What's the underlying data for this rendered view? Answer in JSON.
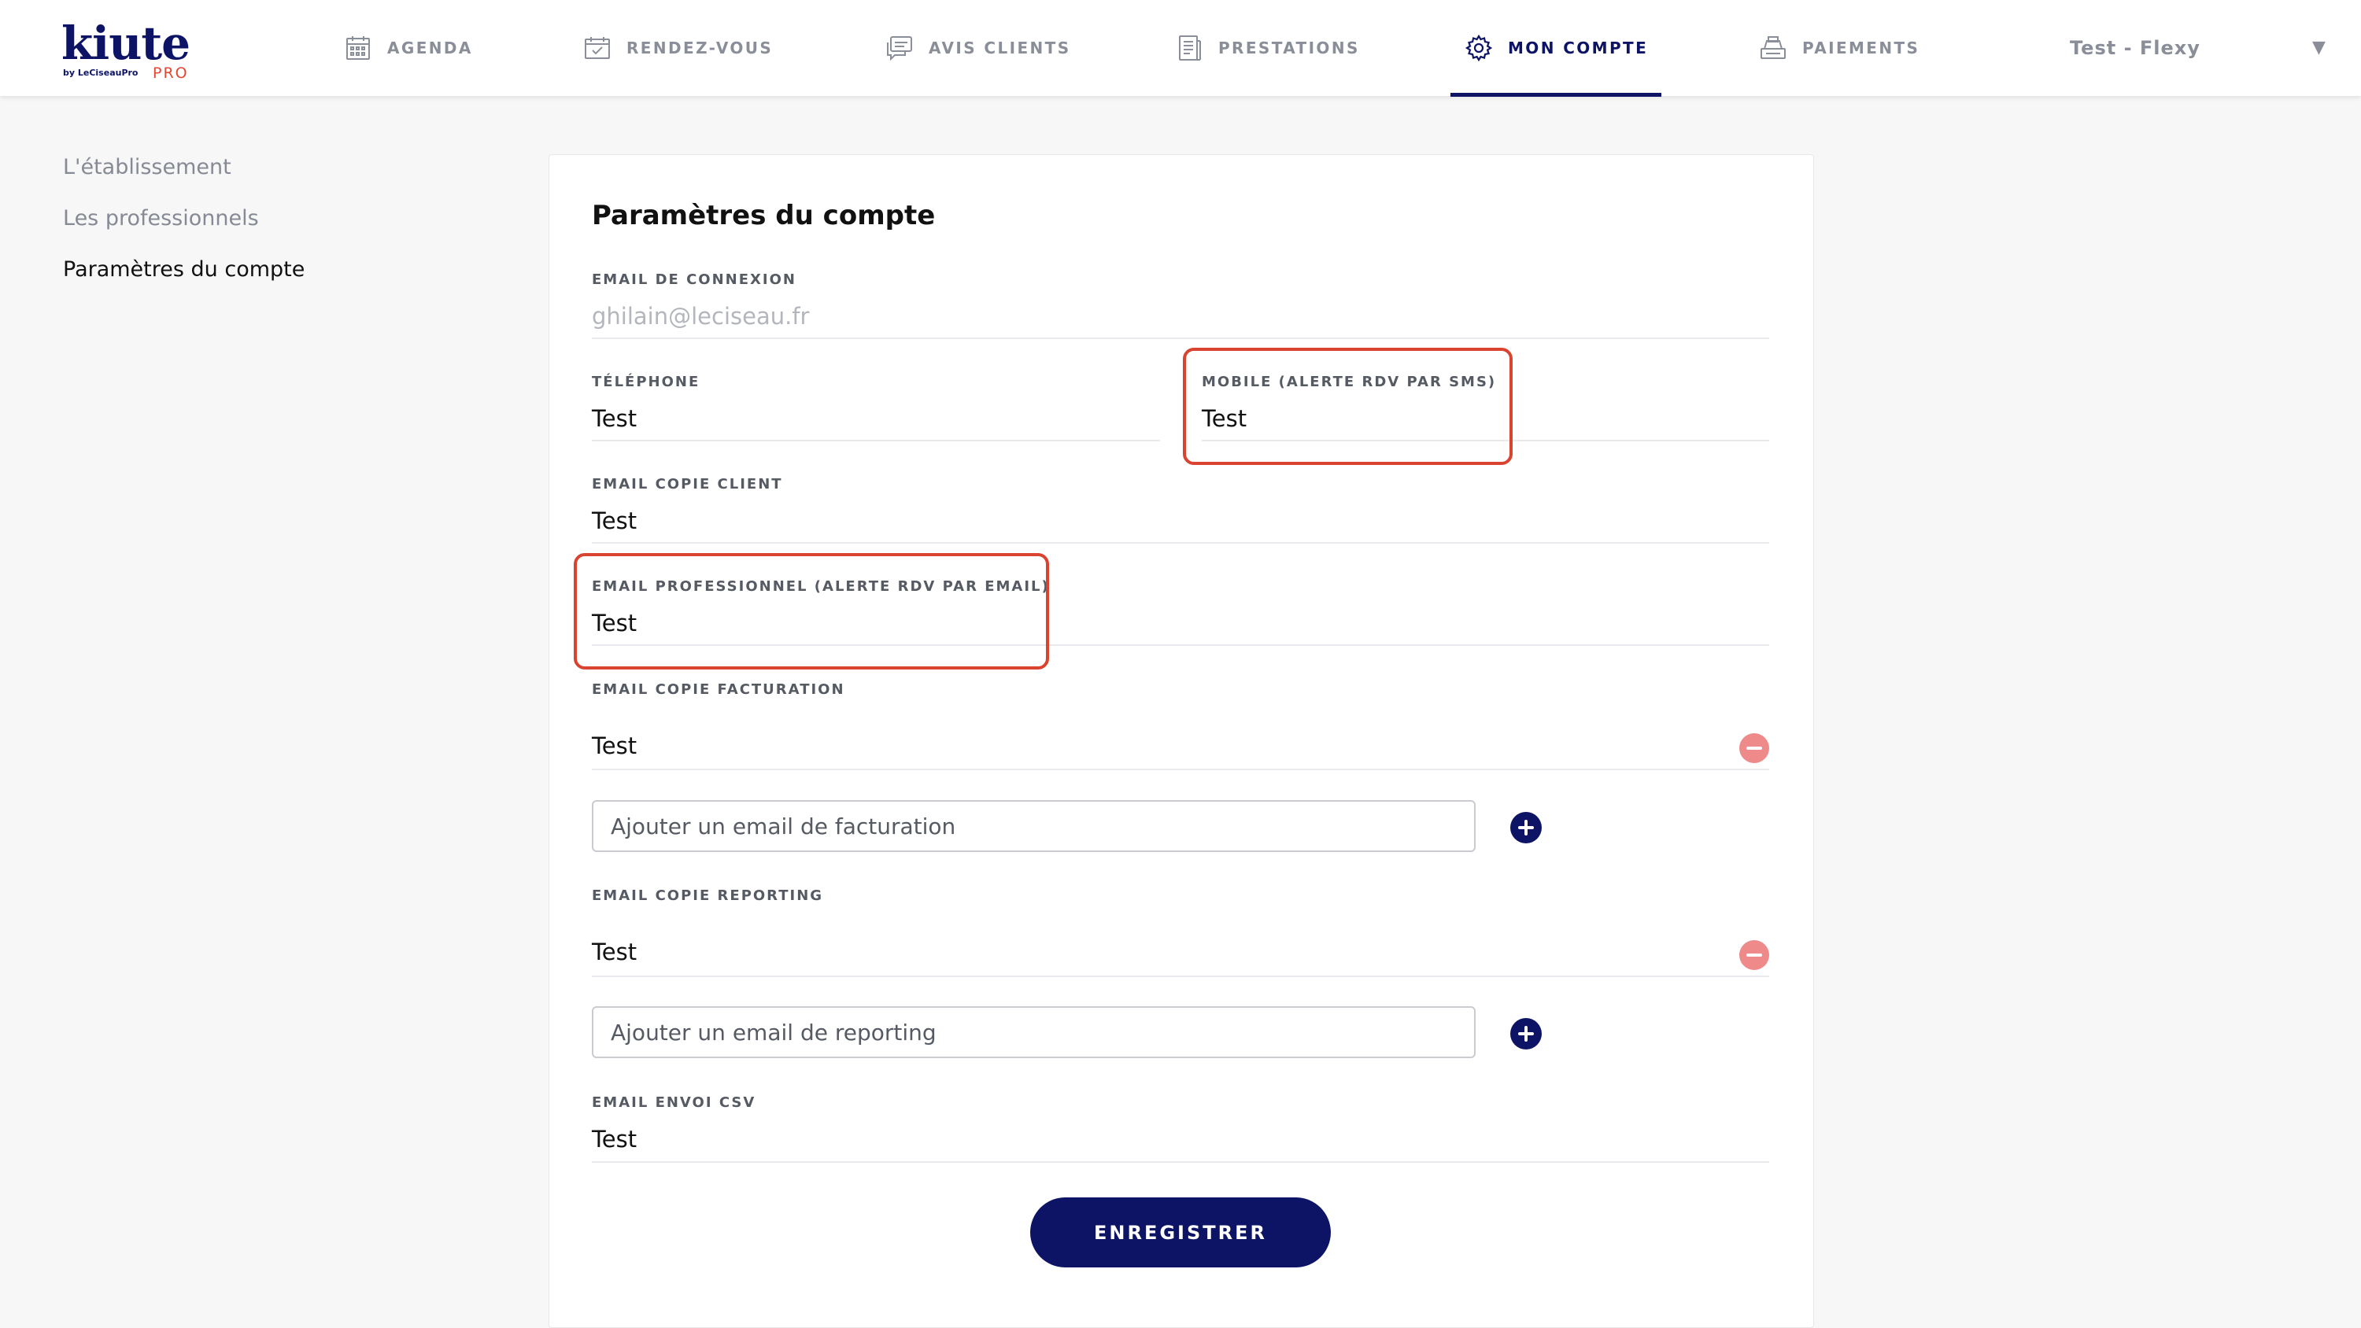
{
  "brand": {
    "name": "kiute",
    "by": "by LeCiseauPro",
    "tag": "PRO"
  },
  "nav": {
    "agenda": "AGENDA",
    "rendez_vous": "RENDEZ-VOUS",
    "avis_clients": "AVIS CLIENTS",
    "prestations": "PRESTATIONS",
    "mon_compte": "MON COMPTE",
    "paiements": "PAIEMENTS",
    "active": "MON COMPTE"
  },
  "user": {
    "name": "Test - Flexy",
    "caret": "▼"
  },
  "sidebar": {
    "items": [
      {
        "label": "L'établissement"
      },
      {
        "label": "Les professionnels"
      },
      {
        "label": "Paramètres du compte"
      }
    ]
  },
  "form": {
    "title": "Paramètres du compte",
    "email_connexion": {
      "label": "EMAIL DE CONNEXION",
      "value": "ghilain@leciseau.fr"
    },
    "telephone": {
      "label": "TÉLÉPHONE",
      "value": "Test"
    },
    "mobile": {
      "label": "MOBILE (ALERTE RDV PAR SMS)",
      "value": "Test"
    },
    "email_copie_client": {
      "label": "EMAIL COPIE CLIENT",
      "value": "Test"
    },
    "email_professionnel": {
      "label": "EMAIL PROFESSIONNEL (ALERTE RDV PAR EMAIL)",
      "value": "Test"
    },
    "email_copie_facturation": {
      "label": "EMAIL COPIE FACTURATION",
      "value": "Test",
      "add_placeholder": "Ajouter un email de facturation"
    },
    "email_copie_reporting": {
      "label": "EMAIL COPIE REPORTING",
      "value": "Test",
      "add_placeholder": "Ajouter un email de reporting"
    },
    "email_envoi_csv": {
      "label": "EMAIL ENVOI CSV",
      "value": "Test"
    },
    "save_label": "ENREGISTRER"
  },
  "colors": {
    "brand_navy": "#0d1466",
    "highlight_red": "#d9432f",
    "remove_pink": "#ee8a8a",
    "logo_pro_orange": "#e5462e"
  }
}
